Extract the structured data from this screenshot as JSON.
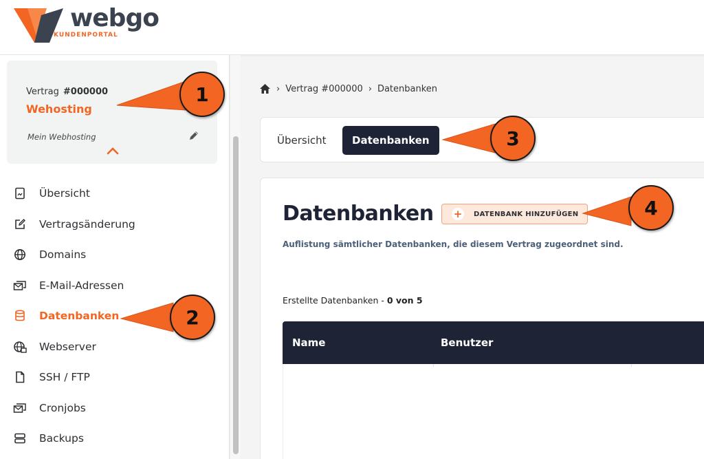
{
  "brand": {
    "name": "webgo",
    "subline": "KUNDENPORTAL",
    "accent_color": "#f26522",
    "dark_color": "#1e2435"
  },
  "contract": {
    "label": "Vertrag",
    "number": "#000000",
    "product": "Wehosting",
    "description": "Mein Webhosting"
  },
  "sidebar": {
    "items": [
      {
        "label": "Übersicht",
        "icon": "document-icon",
        "active": false
      },
      {
        "label": "Vertragsänderung",
        "icon": "edit-icon",
        "active": false
      },
      {
        "label": "Domains",
        "icon": "globe-icon",
        "active": false
      },
      {
        "label": "E-Mail-Adressen",
        "icon": "mail-icon",
        "active": false
      },
      {
        "label": "Datenbanken",
        "icon": "database-icon",
        "active": true
      },
      {
        "label": "Webserver",
        "icon": "webserver-icon",
        "active": false
      },
      {
        "label": "SSH / FTP",
        "icon": "file-icon",
        "active": false
      },
      {
        "label": "Cronjobs",
        "icon": "cron-icon",
        "active": false
      },
      {
        "label": "Backups",
        "icon": "server-icon",
        "active": false
      }
    ]
  },
  "breadcrumb": {
    "items": [
      "Vertrag #000000",
      "Datenbanken"
    ]
  },
  "tabs": [
    {
      "label": "Übersicht",
      "active": false
    },
    {
      "label": "Datenbanken",
      "active": true
    }
  ],
  "main": {
    "title": "Datenbanken",
    "add_button_label": "DATENBANK HINZUFÜGEN",
    "subtitle": "Auflistung sämtlicher Datenbanken, die diesem Vertrag zugeordnet sind.",
    "count_label": "Erstellte Datenbanken - ",
    "count_value": "0 von 5",
    "table_headers": [
      "Name",
      "Benutzer"
    ]
  },
  "callouts": [
    "1",
    "2",
    "3",
    "4"
  ]
}
